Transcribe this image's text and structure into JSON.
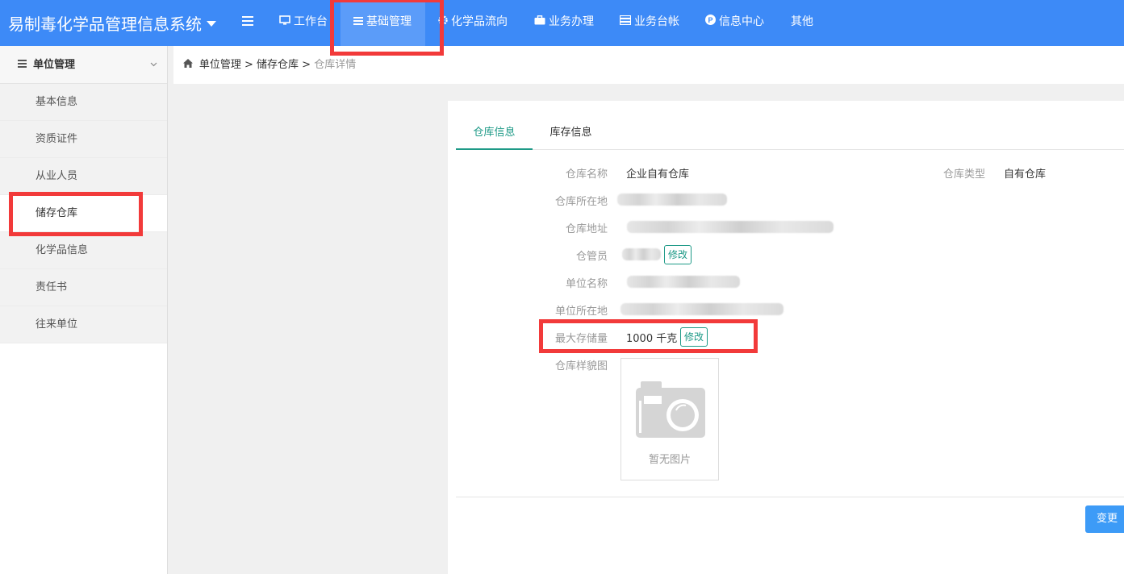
{
  "app": {
    "title": "易制毒化学品管理信息系统"
  },
  "nav": {
    "items": [
      {
        "label": "工作台",
        "icon": "monitor-icon"
      },
      {
        "label": "基础管理",
        "icon": "menu-icon"
      },
      {
        "label": "化学品流向",
        "icon": "gear-icon"
      },
      {
        "label": "业务办理",
        "icon": "briefcase-icon"
      },
      {
        "label": "业务台帐",
        "icon": "server-icon"
      },
      {
        "label": "信息中心",
        "icon": "p-circle-icon"
      },
      {
        "label": "其他",
        "icon": ""
      }
    ],
    "active": "基础管理"
  },
  "sidebar": {
    "header": "单位管理",
    "items": [
      {
        "label": "基本信息"
      },
      {
        "label": "资质证件"
      },
      {
        "label": "从业人员"
      },
      {
        "label": "储存仓库"
      },
      {
        "label": "化学品信息"
      },
      {
        "label": "责任书"
      },
      {
        "label": "往来单位"
      }
    ],
    "active": "储存仓库"
  },
  "breadcrumb": {
    "part1": "单位管理",
    "part2": "储存仓库",
    "current": "仓库详情",
    "separator": ">"
  },
  "tabs": [
    {
      "label": "仓库信息"
    },
    {
      "label": "库存信息"
    }
  ],
  "fields": {
    "warehouse_name": {
      "label": "仓库名称",
      "value": "企业自有仓库"
    },
    "warehouse_type": {
      "label": "仓库类型",
      "value": "自有仓库"
    },
    "warehouse_region": {
      "label": "仓库所在地"
    },
    "warehouse_address": {
      "label": "仓库地址"
    },
    "keeper": {
      "label": "仓管员",
      "edit_label": "修改"
    },
    "unit_name": {
      "label": "单位名称"
    },
    "unit_region": {
      "label": "单位所在地"
    },
    "max_storage": {
      "label": "最大存储量",
      "value": "1000 千克",
      "edit_label": "修改"
    },
    "photo": {
      "label": "仓库样貌图",
      "placeholder": "暂无图片"
    }
  },
  "actions": {
    "change_label": "变更"
  },
  "colors": {
    "topbar": "#3d8af7",
    "accent": "#1e9a87",
    "highlight": "#f23a3a"
  }
}
